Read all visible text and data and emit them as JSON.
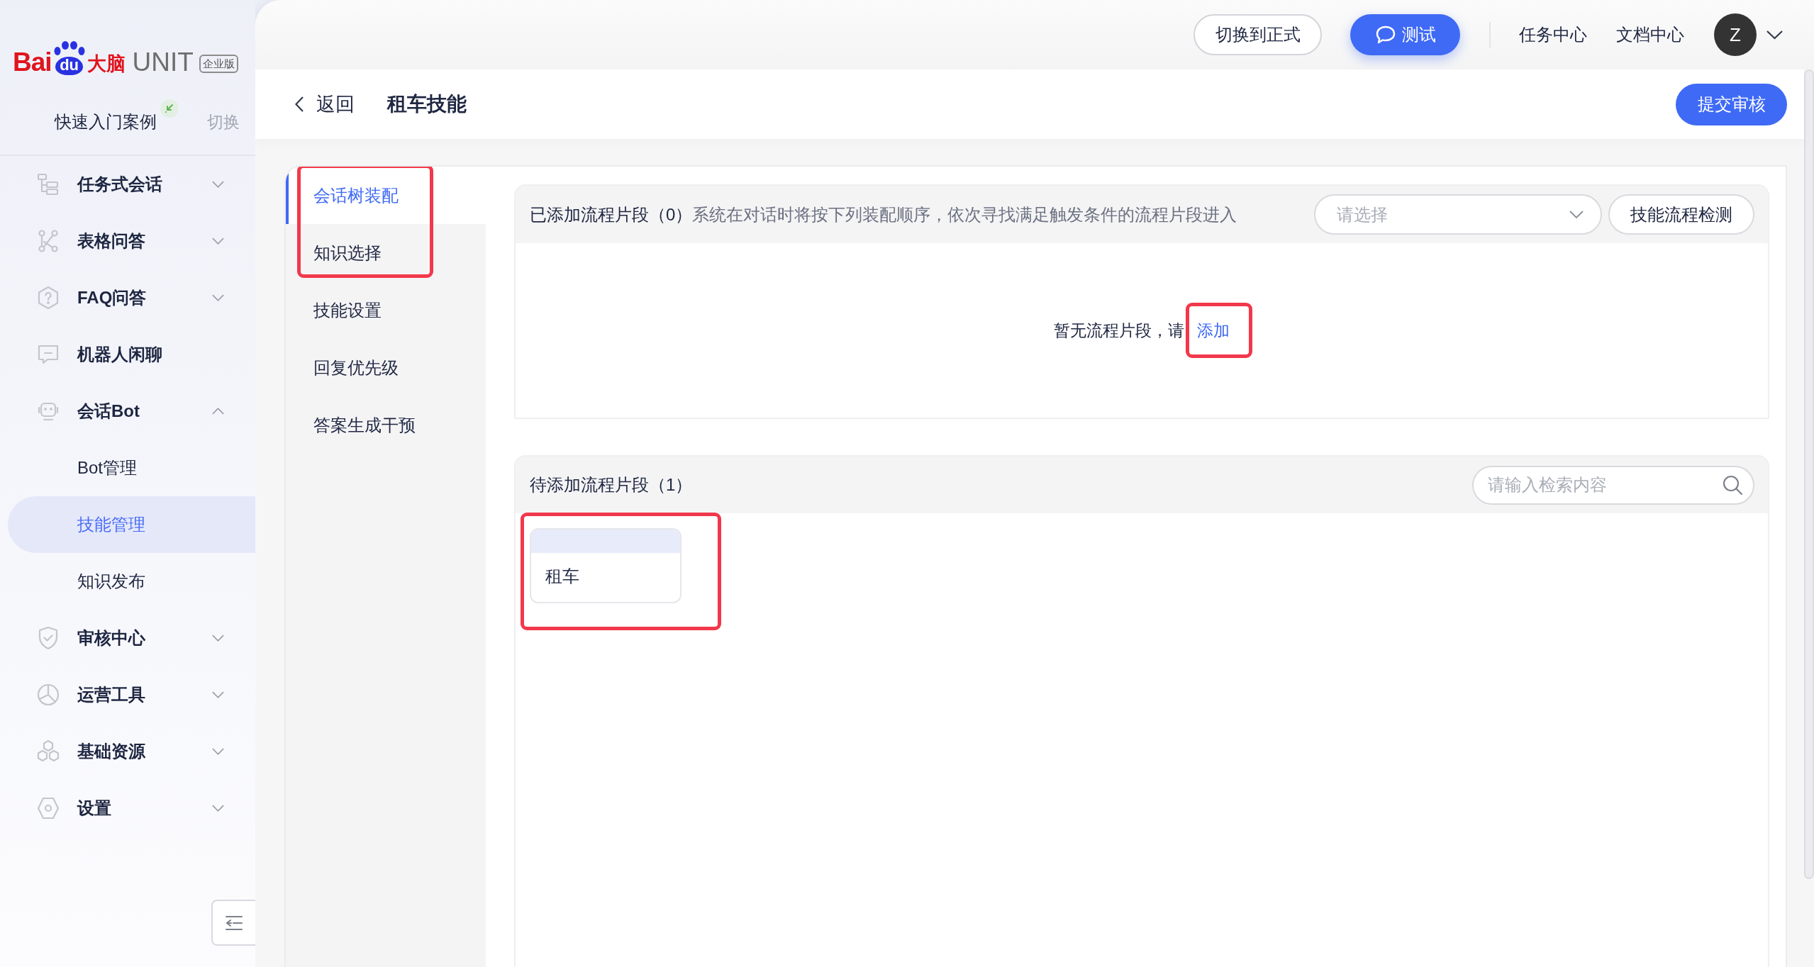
{
  "sidebar": {
    "logo": {
      "brand_left": "Bai",
      "paw_text": "du",
      "brand_right": "大脑",
      "product": "UNIT",
      "edition": "企业版"
    },
    "project": {
      "name": "快速入门案例",
      "switch_label": "切换"
    },
    "menu": [
      {
        "label": "任务式会话",
        "kind": "group",
        "expanded": false,
        "selected": false
      },
      {
        "label": "表格问答",
        "kind": "group",
        "expanded": false,
        "selected": false
      },
      {
        "label": "FAQ问答",
        "kind": "group",
        "expanded": false,
        "selected": false
      },
      {
        "label": "机器人闲聊",
        "kind": "link",
        "selected": false
      },
      {
        "label": "会话Bot",
        "kind": "group",
        "expanded": true,
        "selected": false,
        "children": [
          {
            "label": "Bot管理",
            "selected": false
          },
          {
            "label": "技能管理",
            "selected": true
          },
          {
            "label": "知识发布",
            "selected": false
          }
        ]
      },
      {
        "label": "审核中心",
        "kind": "group",
        "expanded": false,
        "selected": false
      },
      {
        "label": "运营工具",
        "kind": "group",
        "expanded": false,
        "selected": false
      },
      {
        "label": "基础资源",
        "kind": "group",
        "expanded": false,
        "selected": false
      },
      {
        "label": "设置",
        "kind": "group",
        "expanded": false,
        "selected": false
      }
    ]
  },
  "topbar": {
    "buttons": [
      {
        "label": "切换到正式",
        "kind": "outline"
      },
      {
        "label": "测试",
        "kind": "primary"
      }
    ],
    "links": [
      "任务中心",
      "文档中心"
    ],
    "avatar": "Z"
  },
  "header": {
    "back": "返回",
    "title": "租车技能",
    "submit": "提交审核"
  },
  "subnav": [
    {
      "label": "会话树装配",
      "selected": true,
      "annotated": true
    },
    {
      "label": "知识选择",
      "selected": false,
      "annotated": true
    },
    {
      "label": "技能设置",
      "selected": false,
      "annotated": false
    },
    {
      "label": "回复优先级",
      "selected": false,
      "annotated": false
    },
    {
      "label": "答案生成干预",
      "selected": false,
      "annotated": false
    }
  ],
  "added_panel": {
    "title": "已添加流程片段（0）",
    "description": "系统在对话时将按下列装配顺序，依次寻找满足触发条件的流程片段进入",
    "select": {
      "placeholder": "请选择"
    },
    "check_button": "技能流程检测",
    "empty": {
      "text": "暂无流程片段，请",
      "link": "添加",
      "annotated": true
    }
  },
  "pending_panel": {
    "title": "待添加流程片段（1）",
    "search": {
      "placeholder": "请输入检索内容"
    },
    "cards": [
      {
        "label": "租车",
        "annotated": true
      }
    ]
  }
}
